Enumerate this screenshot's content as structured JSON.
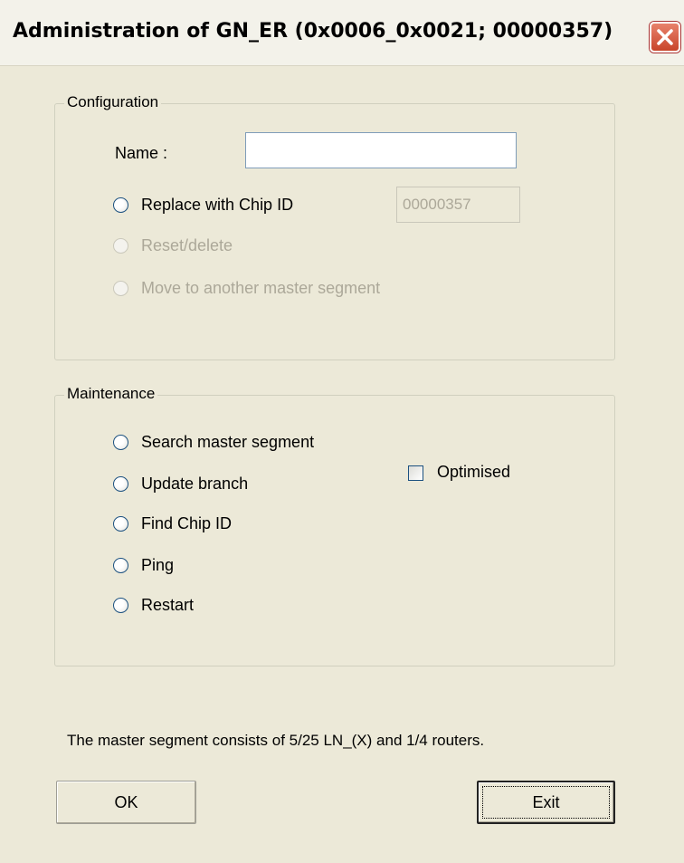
{
  "window": {
    "title": "Administration of GN_ER (0x0006_0x0021; 00000357)"
  },
  "configuration": {
    "legend": "Configuration",
    "name_label": "Name :",
    "name_value": "",
    "replace_label": "Replace with Chip ID",
    "chip_id_value": "00000357",
    "reset_label": "Reset/delete",
    "move_label": "Move to another master segment"
  },
  "maintenance": {
    "legend": "Maintenance",
    "options": [
      {
        "label": "Search master segment"
      },
      {
        "label": "Update branch"
      },
      {
        "label": "Find Chip ID"
      },
      {
        "label": "Ping"
      },
      {
        "label": "Restart"
      }
    ],
    "optimised_label": "Optimised",
    "optimised_checked": false
  },
  "status_text": "The master segment consists of 5/25 LN_(X) and 1/4 routers.",
  "buttons": {
    "ok_label": "OK",
    "exit_label": "Exit"
  },
  "icons": {
    "close": "close-icon"
  }
}
